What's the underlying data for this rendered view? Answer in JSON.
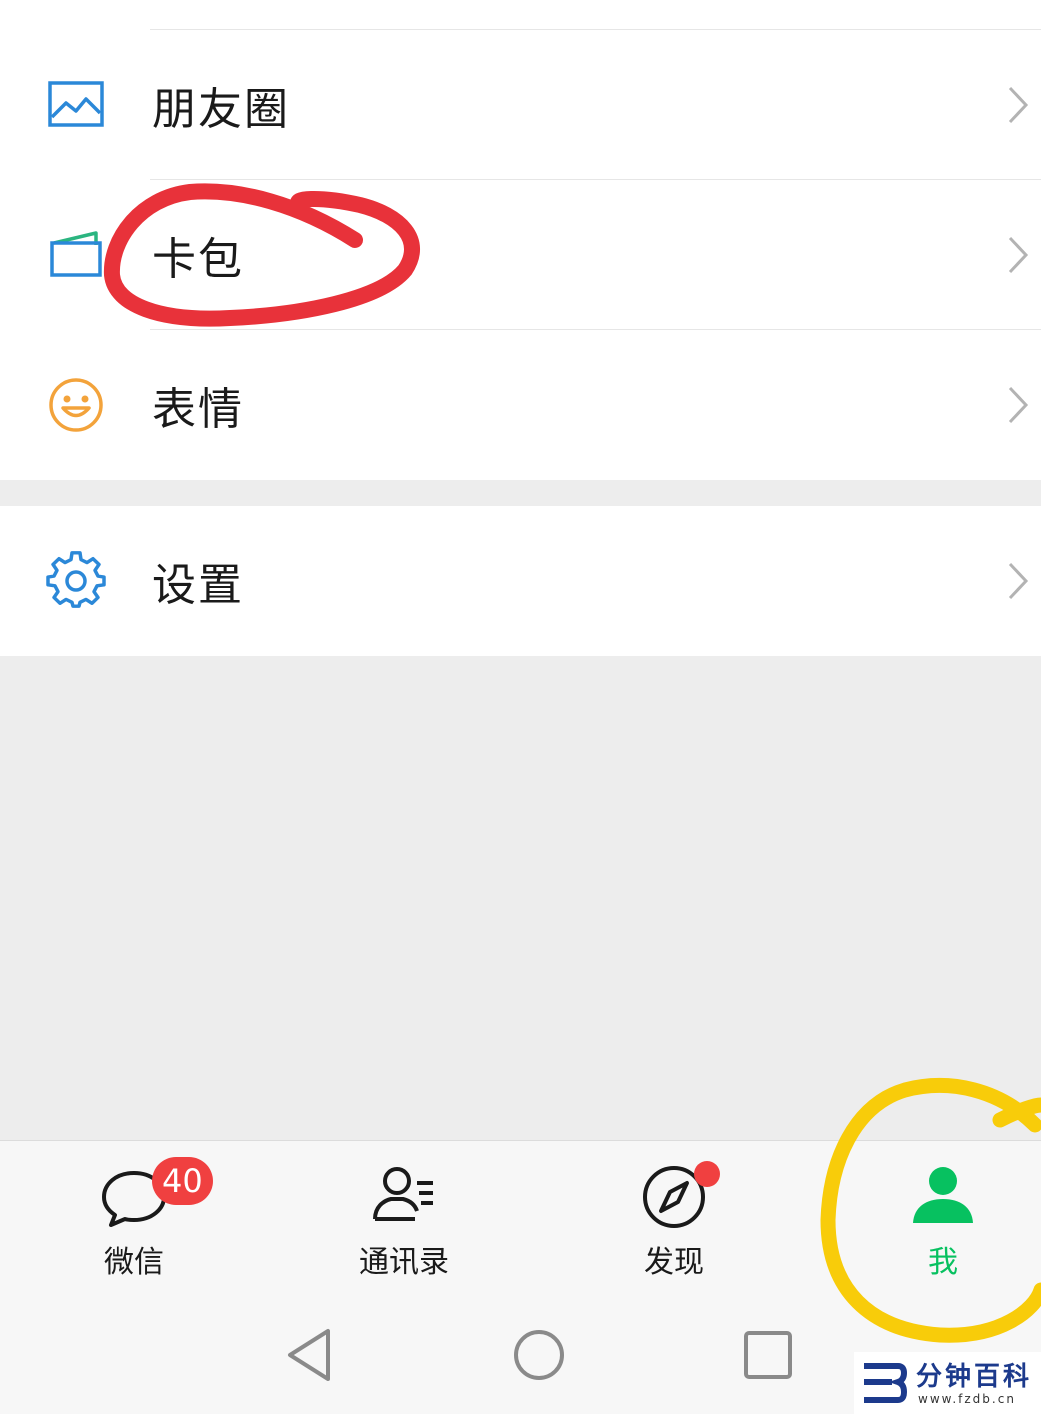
{
  "menu": {
    "moments": "朋友圈",
    "cards": "卡包",
    "stickers": "表情",
    "settings": "设置"
  },
  "tabbar": {
    "chats": {
      "label": "微信",
      "badge": "40"
    },
    "contacts": {
      "label": "通讯录"
    },
    "discover": {
      "label": "发现"
    },
    "me": {
      "label": "我"
    }
  },
  "watermark": {
    "brand": "分钟百科",
    "url": "www.fzdb.cn"
  },
  "colors": {
    "accent_green": "#07c160",
    "icon_blue": "#2b88d8",
    "icon_orange": "#f3a33b",
    "badge_red": "#f04040",
    "annotation_red": "#e8323a",
    "annotation_yellow": "#f8cc0a"
  },
  "icons": {
    "moments": "picture-icon",
    "cards": "wallet-icon",
    "stickers": "smiley-icon",
    "settings": "gear-icon",
    "chats": "chat-bubble-icon",
    "contacts": "contacts-icon",
    "discover": "compass-icon",
    "me": "person-icon"
  }
}
